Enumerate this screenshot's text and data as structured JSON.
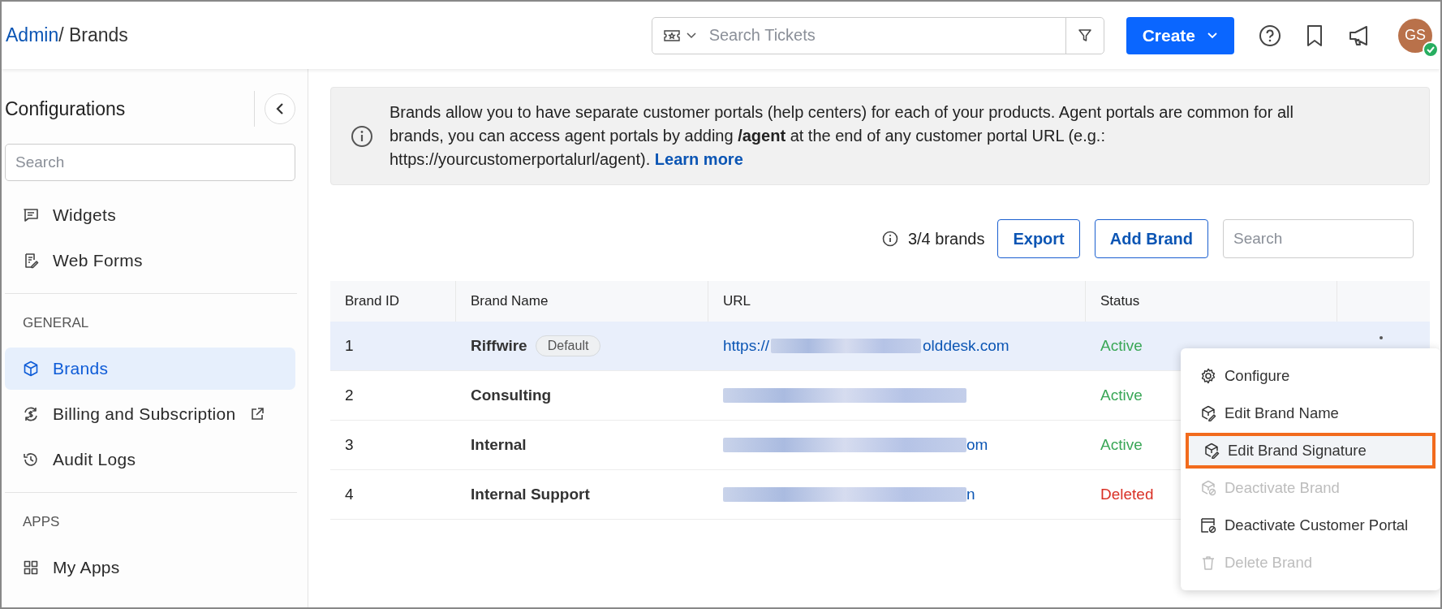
{
  "header": {
    "breadcrumb": [
      {
        "label": "Admin",
        "link": true
      },
      {
        "label": "/ Brands",
        "link": false
      }
    ],
    "search": {
      "placeholder": "Search Tickets"
    },
    "create_button": "Create",
    "avatar": {
      "initials": "GS",
      "online": true
    }
  },
  "sidebar": {
    "title": "Configurations",
    "search": {
      "placeholder": "Search"
    },
    "sections": [
      {
        "items": [
          {
            "label": "Widgets",
            "kind": "widgets",
            "selected": false,
            "external": false
          },
          {
            "label": "Web Forms",
            "kind": "forms",
            "selected": false,
            "external": false
          }
        ]
      },
      {
        "heading": "GENERAL",
        "items": [
          {
            "label": "Brands",
            "kind": "brands",
            "selected": true,
            "external": false
          },
          {
            "label": "Billing and Subscription",
            "kind": "billing",
            "selected": false,
            "external": true
          },
          {
            "label": "Audit Logs",
            "kind": "audit",
            "selected": false,
            "external": false
          }
        ]
      },
      {
        "heading": "APPS",
        "items": [
          {
            "label": "My Apps",
            "kind": "apps",
            "selected": false,
            "external": false
          }
        ]
      }
    ]
  },
  "info_banner": {
    "text": "Brands allow you to have separate customer portals (help centers) for each of your products. Agent portals are common for all brands, you can access agent portals by adding **/agent** at the end of any customer portal URL (e.g.: https://yourcustomerportalurl/agent).",
    "link": "Learn more"
  },
  "toolbar": {
    "count": "3/4 brands",
    "buttons": [
      "Export",
      "Add Brand"
    ],
    "search": {
      "placeholder": "Search"
    }
  },
  "table": {
    "columns": [
      "Brand ID",
      "Brand Name",
      "URL",
      "Status"
    ],
    "rows": [
      {
        "id": "1",
        "name": "Riffwire",
        "badge": "Default",
        "url_prefix": "https://",
        "url_suffix": "olddesk.com",
        "status": "Active",
        "color": "#3aa757",
        "selected": true
      },
      {
        "id": "2",
        "name": "Consulting",
        "badge": null,
        "url_prefix": "",
        "url_suffix": "",
        "status": "Active",
        "color": "#3aa757",
        "selected": false
      },
      {
        "id": "3",
        "name": "Internal",
        "badge": null,
        "url_prefix": "",
        "url_suffix": "om",
        "status": "Active",
        "color": "#3aa757",
        "selected": false
      },
      {
        "id": "4",
        "name": "Internal Support",
        "badge": null,
        "url_prefix": "",
        "url_suffix": "n",
        "status": "Deleted",
        "color": "#d93025",
        "selected": false
      }
    ]
  },
  "context_menu": [
    {
      "label": "Configure",
      "kind": "gear",
      "disabled": false,
      "selected": false
    },
    {
      "label": "Edit Brand Name",
      "kind": "edit",
      "disabled": false,
      "selected": false
    },
    {
      "label": "Edit Brand Signature",
      "kind": "edit",
      "disabled": false,
      "selected": true
    },
    {
      "label": "Deactivate Brand",
      "kind": "deactivate",
      "disabled": true,
      "selected": false
    },
    {
      "label": "Deactivate Customer Portal",
      "kind": "portal",
      "disabled": false,
      "selected": false
    },
    {
      "label": "Delete Brand",
      "kind": "trash",
      "disabled": true,
      "selected": false
    }
  ]
}
